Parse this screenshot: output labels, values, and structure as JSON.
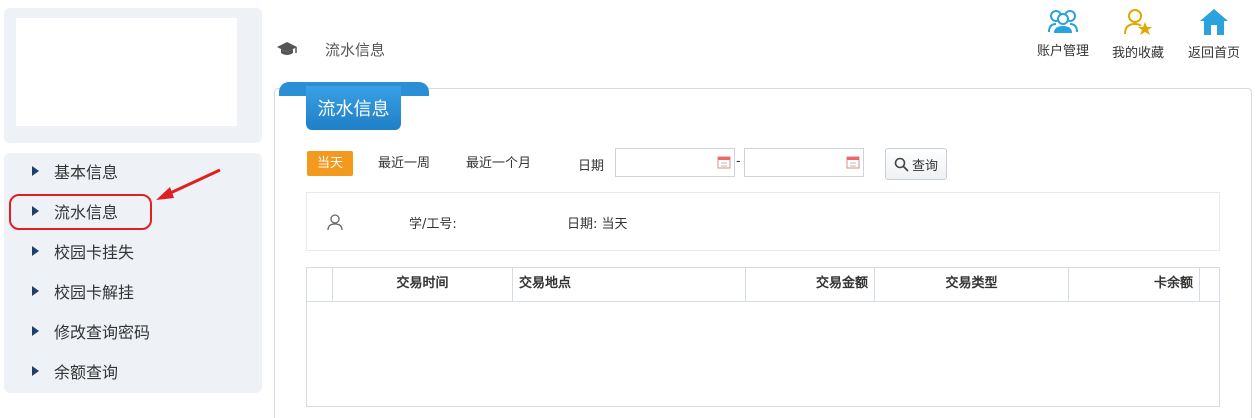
{
  "breadcrumb": {
    "text": "流水信息",
    "icon": "graduation-cap-icon"
  },
  "top_actions": [
    {
      "label": "账户管理",
      "icon": "users-icon",
      "color": "#2aa3dc"
    },
    {
      "label": "我的收藏",
      "icon": "user-star-icon",
      "color": "#e0a800"
    },
    {
      "label": "返回首页",
      "icon": "home-icon",
      "color": "#2aa3dc"
    }
  ],
  "sidebar": {
    "items": [
      {
        "label": "基本信息"
      },
      {
        "label": "流水信息"
      },
      {
        "label": "校园卡挂失"
      },
      {
        "label": "校园卡解挂"
      },
      {
        "label": "修改查询密码"
      },
      {
        "label": "余额查询"
      }
    ],
    "selected": "流水信息"
  },
  "panel": {
    "title": "流水信息"
  },
  "filters": {
    "chips": [
      {
        "label": "当天",
        "active": true
      },
      {
        "label": "最近一周",
        "active": false
      },
      {
        "label": "最近一个月",
        "active": false
      }
    ],
    "date_label": "日期",
    "date_from": "",
    "date_to": "",
    "separator": "-",
    "search_label": "查询"
  },
  "info": {
    "student_id_label": "学/工号:",
    "date_text": "日期: 当天"
  },
  "table": {
    "columns": [
      "交易时间",
      "交易地点",
      "交易金额",
      "交易类型",
      "卡余额"
    ],
    "rows": []
  },
  "colors": {
    "accent": "#2b8fd6",
    "active_chip": "#f39a1e",
    "annotation": "#e02020"
  }
}
